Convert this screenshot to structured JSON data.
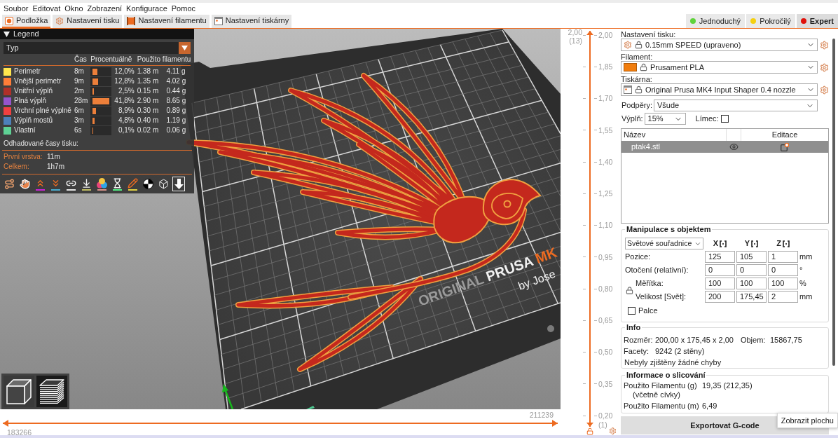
{
  "menu": [
    "Soubor",
    "Editovat",
    "Okno",
    "Zobrazení",
    "Konfigurace",
    "Pomoc"
  ],
  "tabs": [
    {
      "kind": "plater",
      "label": "Podložka",
      "selected": true
    },
    {
      "kind": "print",
      "label": "Nastavení tisku",
      "selected": false
    },
    {
      "kind": "filament",
      "label": "Nastavení filamentu",
      "selected": false
    },
    {
      "kind": "printer",
      "label": "Nastavení tiskárny",
      "selected": false
    }
  ],
  "modes": [
    {
      "label": "Jednoduchý",
      "color": "#5fd33a",
      "selected": false
    },
    {
      "label": "Pokročilý",
      "color": "#f5d00f",
      "selected": false
    },
    {
      "label": "Expert",
      "color": "#e0120b",
      "selected": true
    }
  ],
  "viewport": {
    "legend": {
      "title": "Legend",
      "expanded": true,
      "view_type": "Typ",
      "columns": {
        "time": "Čas",
        "percent": "Procentuálně",
        "filament": "Použito filamentu"
      },
      "rows": [
        {
          "name": "Perimetr",
          "color": "#ffe64d",
          "time": "8m",
          "level": 0.29,
          "percent": "12,0%",
          "length": "1.38 m",
          "weight": "4.11 g"
        },
        {
          "name": "Vnější perimetr",
          "color": "#ff7d38",
          "time": "9m",
          "level": 0.31,
          "percent": "12,8%",
          "length": "1.35 m",
          "weight": "4.02 g"
        },
        {
          "name": "Vnitřní výplň",
          "color": "#b03029",
          "time": "2m",
          "level": 0.06,
          "percent": "2,5%",
          "length": "0.15 m",
          "weight": "0.44 g"
        },
        {
          "name": "Plná výplň",
          "color": "#9654cc",
          "time": "28m",
          "level": 1,
          "percent": "41,8%",
          "length": "2.90 m",
          "weight": "8.65 g"
        },
        {
          "name": "Vrchní plné výplně",
          "color": "#f04040",
          "time": "6m",
          "level": 0.21,
          "percent": "8,9%",
          "length": "0.30 m",
          "weight": "0.89 g"
        },
        {
          "name": "Výplň mostů",
          "color": "#4d80ba",
          "time": "3m",
          "level": 0.11,
          "percent": "4,8%",
          "length": "0.40 m",
          "weight": "1.19 g"
        },
        {
          "name": "Vlastní",
          "color": "#5ed194",
          "time": "6s",
          "level": 0.02,
          "percent": "0,1%",
          "length": "0.02 m",
          "weight": "0.06 g"
        }
      ],
      "estimates_title": "Odhadované časy tisku:",
      "estimates": [
        {
          "label": "První vrstva:",
          "value": "11m"
        },
        {
          "label": "Celkem:",
          "value": "1h7m"
        }
      ],
      "options": [
        {
          "kind": "travel",
          "selected": false
        },
        {
          "kind": "wipe",
          "selected": false
        },
        {
          "kind": "retractions",
          "selected": false,
          "color": "#cd22d6"
        },
        {
          "kind": "deretractions",
          "selected": false,
          "color": "#49adcf"
        },
        {
          "kind": "seams",
          "selected": false,
          "color": "#e6e6e6"
        },
        {
          "kind": "tool_changes",
          "selected": false,
          "color": "#c1be63"
        },
        {
          "kind": "color_changes",
          "selected": false,
          "color": "#da948b"
        },
        {
          "kind": "pauses",
          "selected": false,
          "color": "#52f083"
        },
        {
          "kind": "custom_gcode",
          "selected": false,
          "color": "#e2d243"
        },
        {
          "kind": "center_of_gravity",
          "selected": false
        },
        {
          "kind": "shells",
          "selected": false
        },
        {
          "kind": "tool_marker",
          "selected": true
        }
      ]
    },
    "bed_logo": {
      "prefix": "ORIGINAL",
      "brand": "PRUSA",
      "model": "MK",
      "byline": "by Jose"
    },
    "view_buttons": [
      {
        "kind": "model",
        "selected": false
      },
      {
        "kind": "preview",
        "selected": true
      }
    ]
  },
  "horizontal_slider": {
    "lower": {
      "level": 0,
      "label": "183266"
    },
    "upper": {
      "level": 1,
      "label": "211239"
    }
  },
  "vertical_slider": {
    "ticks": [
      "2,00",
      "1,85",
      "1,70",
      "1,55",
      "1,40",
      "1,25",
      "1,10",
      "0,95",
      "0,80",
      "0,65",
      "0,50",
      "0,35",
      "0,20"
    ],
    "upper": {
      "level": 1,
      "value": "2,00",
      "layer": "(13)"
    },
    "lower": {
      "level": 0,
      "layer": "(1)"
    }
  },
  "sidebar": {
    "presets": [
      {
        "kind": "print",
        "label": "Nastavení tisku:",
        "value": "0.15mm SPEED (upraveno)"
      },
      {
        "kind": "filament",
        "label": "Filament:",
        "value": "Prusament PLA"
      },
      {
        "kind": "printer",
        "label": "Tiskárna:",
        "value": "Original Prusa MK4 Input Shaper 0.4 nozzle"
      }
    ],
    "supports": {
      "label": "Podpěry:",
      "value": "Všude"
    },
    "infill": {
      "label": "Výplň:",
      "value": "15%"
    },
    "brim": {
      "label": "Límec:",
      "checked": false
    },
    "object_list": {
      "name_column": "Název",
      "edit_column": "Editace",
      "rows": [
        {
          "name": "ptak4.stl",
          "selected": true
        }
      ]
    },
    "manipulation": {
      "title": "Manipulace s objektem",
      "coordinates": "Světové souřadnice",
      "axes": [
        "X",
        "Y",
        "Z"
      ],
      "rows": [
        {
          "kind": "plain",
          "label": "Pozice:",
          "values": [
            "125",
            "105",
            "1"
          ],
          "unit": "mm"
        },
        {
          "kind": "plain",
          "label": "Otočení (relativní):",
          "values": [
            "0",
            "0",
            "0"
          ],
          "unit": "°"
        },
        {
          "kind": "locked",
          "label": "Měřítka:",
          "values": [
            "100",
            "100",
            "100"
          ],
          "unit": "%"
        },
        {
          "kind": "locked",
          "label": "Velikost [Svět]:",
          "values": [
            "200",
            "175,45",
            "2"
          ],
          "unit": "mm"
        }
      ],
      "inches": {
        "label": "Palce",
        "checked": false
      }
    },
    "info": {
      "title": "Info",
      "size": {
        "label": "Rozměr:",
        "value": "200,00 x 175,45 x 2,00"
      },
      "volume": {
        "label": "Objem:",
        "value": "15867,75"
      },
      "facets": {
        "label": "Facety:",
        "value": "9242 (2 stěny)"
      },
      "errors": "Nebyly zjištěny žádné chyby"
    },
    "slice_info": {
      "title": "Informace o slicování",
      "rows": [
        {
          "label": "Použito Filamentu (g)",
          "note": "(včetně cívky)",
          "value": "19,35 (212,35)"
        },
        {
          "label": "Použito Filamentu (m)",
          "value": "6,49"
        }
      ]
    },
    "export_button": "Exportovat G-code"
  },
  "tooltip": "Zobrazit plochu"
}
